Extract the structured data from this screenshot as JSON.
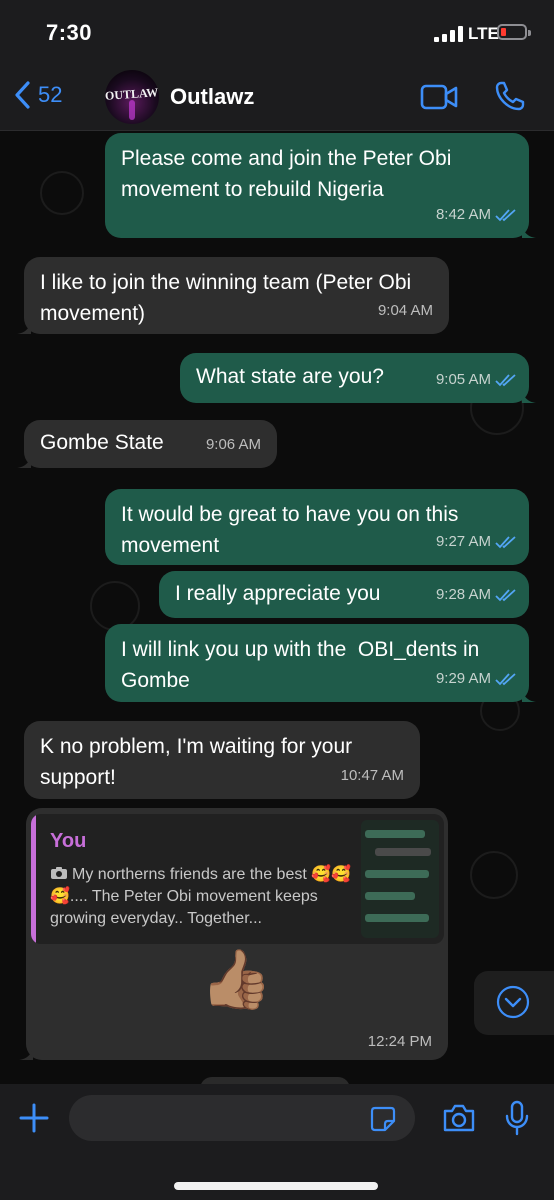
{
  "status_bar": {
    "time": "7:30",
    "network": "LTE"
  },
  "header": {
    "back_count": "52",
    "contact_name": "Outlawz",
    "avatar_text": "OUTLAWZ"
  },
  "messages": [
    {
      "direction": "out",
      "text": "Please come and join the Peter Obi movement to rebuild Nigeria",
      "time": "8:42 AM"
    },
    {
      "direction": "in",
      "text": "I like to join the winning team (Peter Obi movement)",
      "time": "9:04 AM"
    },
    {
      "direction": "out",
      "text": "What state are you?",
      "time": "9:05 AM"
    },
    {
      "direction": "in",
      "text": "Gombe State",
      "time": "9:06 AM"
    },
    {
      "direction": "out",
      "text": "It would be great to have you on this movement",
      "time": "9:27 AM"
    },
    {
      "direction": "out",
      "text": "I really appreciate you",
      "time": "9:28 AM"
    },
    {
      "direction": "out",
      "text": "I will link you up with the  OBI_dents in Gombe",
      "time": "9:29 AM"
    },
    {
      "direction": "in",
      "text": "K no problem, I'm waiting for your support!",
      "time": "10:47 AM"
    }
  ],
  "reply": {
    "quote_author": "You",
    "quote_text": "My northerns friends are the best 🥰🥰🥰.... The Peter Obi movement keeps growing everyday.. Together...",
    "reaction": "👍🏽",
    "time": "12:24 PM"
  },
  "input": {
    "placeholder": ""
  },
  "colors": {
    "accent": "#3d8ef8",
    "outgoing": "#1f5b4a",
    "incoming": "#2e2e2e",
    "quote": "#c76fd9"
  },
  "icons": [
    "back-chevron-icon",
    "video-call-icon",
    "phone-icon",
    "plus-icon",
    "sticker-icon",
    "camera-icon",
    "microphone-icon",
    "scroll-down-icon",
    "double-check-icon",
    "photo-icon"
  ]
}
